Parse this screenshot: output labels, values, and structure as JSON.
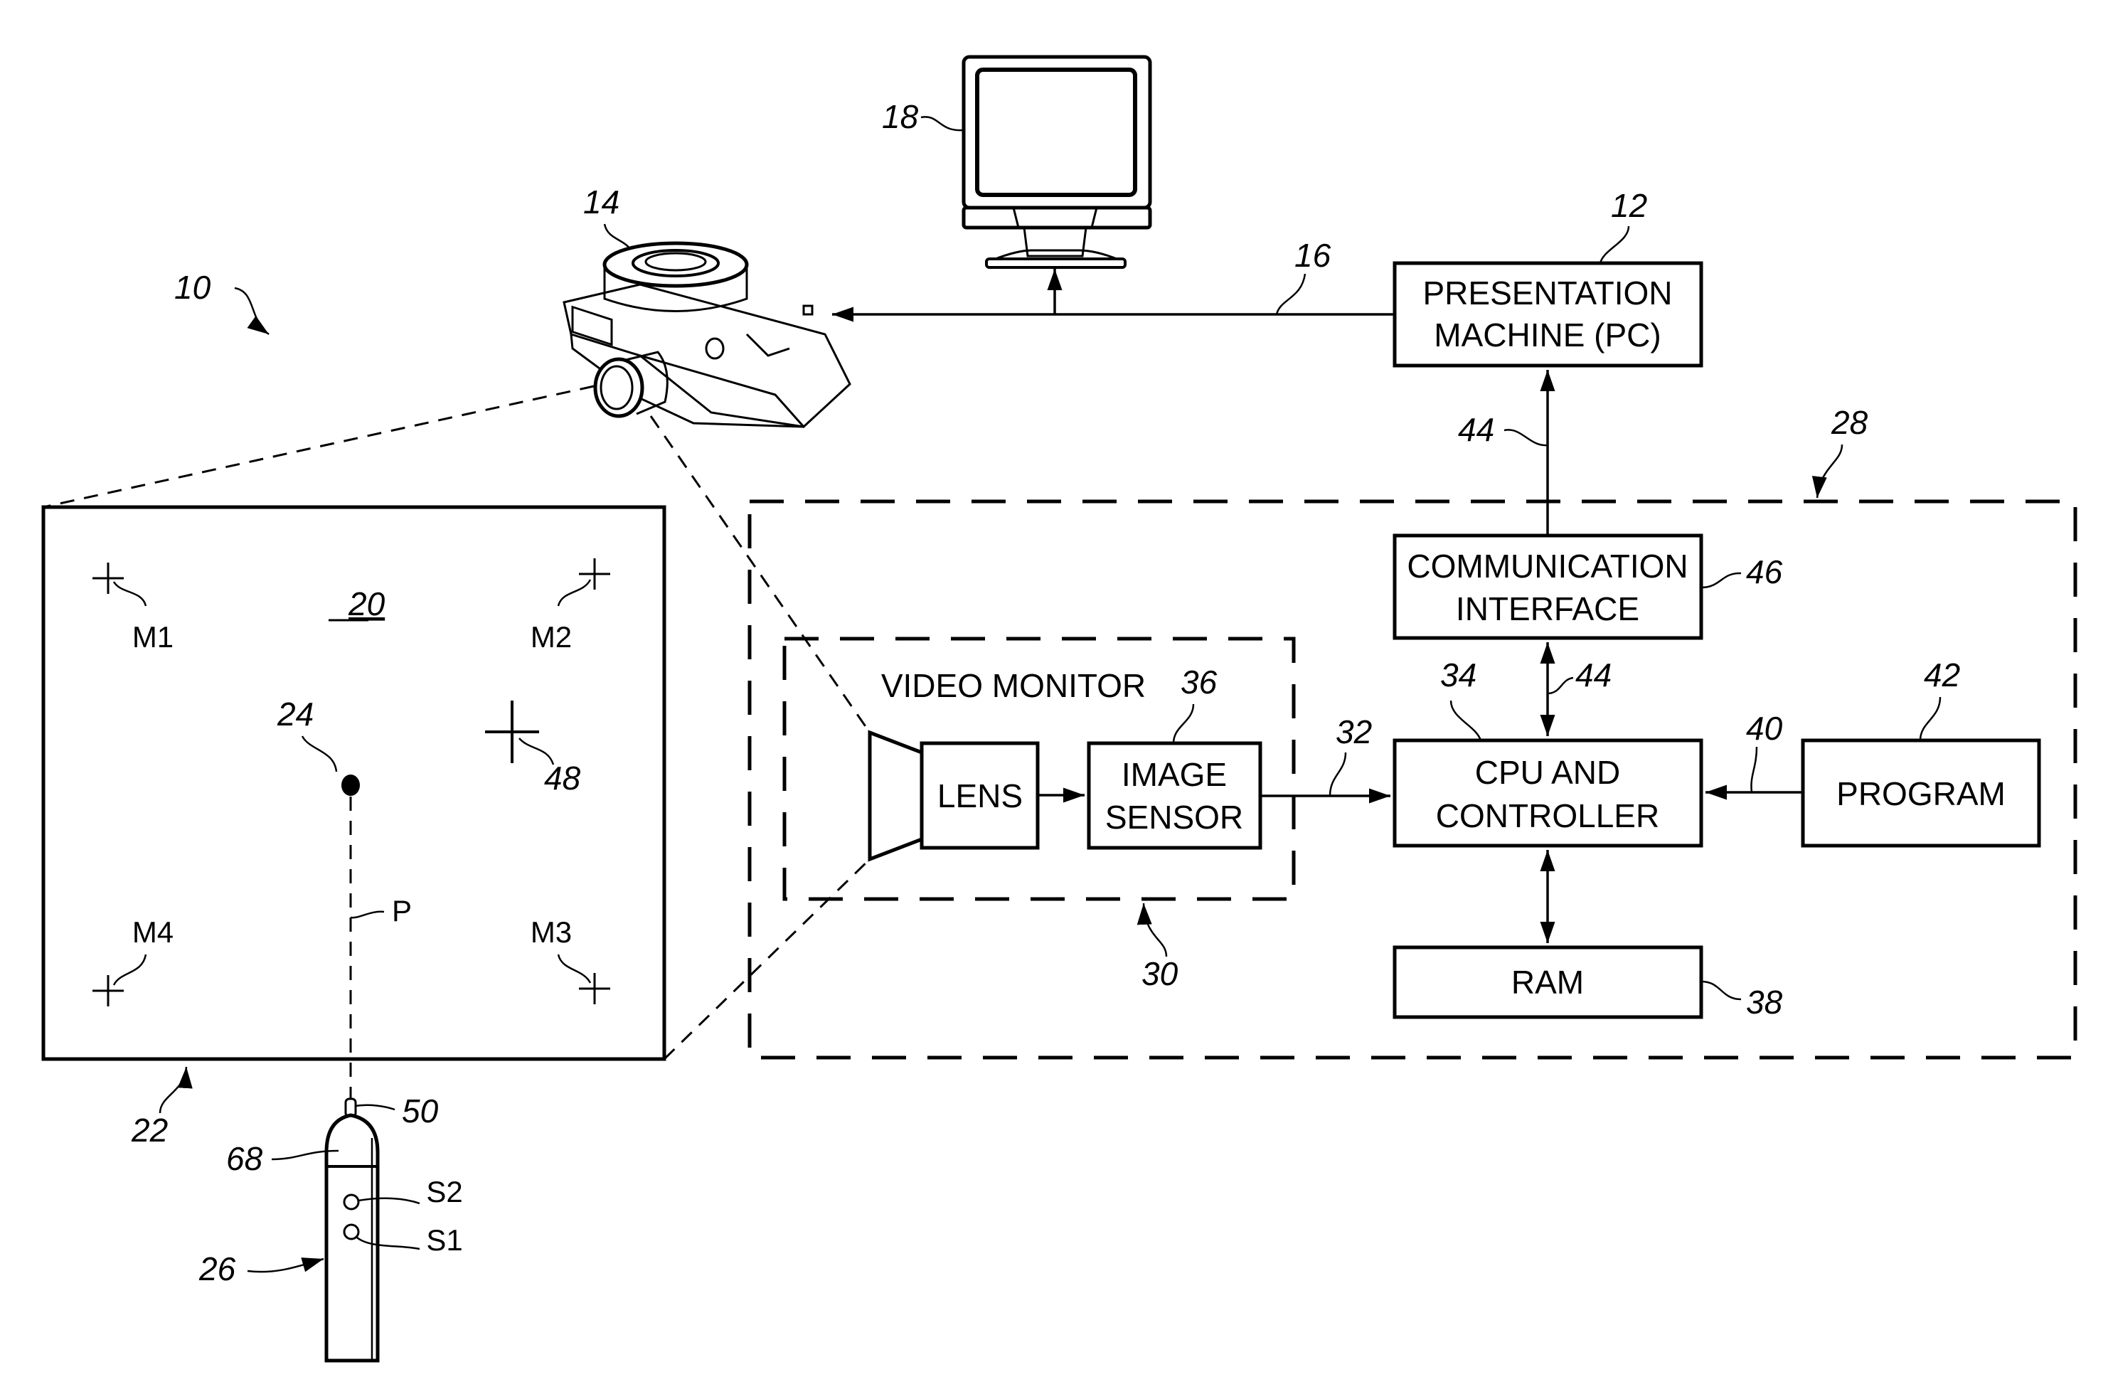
{
  "figure": {
    "system_ref": "10",
    "presentation_machine": {
      "ref": "12",
      "line1": "PRESENTATION",
      "line2": "MACHINE (PC)"
    },
    "projector": {
      "ref": "14"
    },
    "connection": {
      "ref": "16"
    },
    "monitor": {
      "ref": "18"
    },
    "screen": {
      "ref": "22",
      "image_ref": "20",
      "spot_ref": "24",
      "cursor_ref": "48",
      "path_label": "P",
      "markers": [
        "M1",
        "M2",
        "M3",
        "M4"
      ]
    },
    "pointer": {
      "ref": "26",
      "tip_ref": "50",
      "cap_ref": "68",
      "switches": [
        "S2",
        "S1"
      ]
    },
    "processing_unit": {
      "ref": "28"
    },
    "camera": {
      "ref": "30",
      "title": "VIDEO MONITOR",
      "lens_label": "LENS",
      "sensor_ref": "36",
      "sensor_line1": "IMAGE",
      "sensor_line2": "SENSOR"
    },
    "video_signal_ref": "32",
    "cpu": {
      "ref": "34",
      "line1": "CPU AND",
      "line2": "CONTROLLER"
    },
    "ram": {
      "ref": "38",
      "label": "RAM"
    },
    "program_link_ref": "40",
    "program": {
      "ref": "42",
      "label": "PROGRAM"
    },
    "bus_ref_upper": "44",
    "bus_ref_lower": "44",
    "comm_interface": {
      "ref": "46",
      "line1": "COMMUNICATION",
      "line2": "INTERFACE"
    }
  }
}
